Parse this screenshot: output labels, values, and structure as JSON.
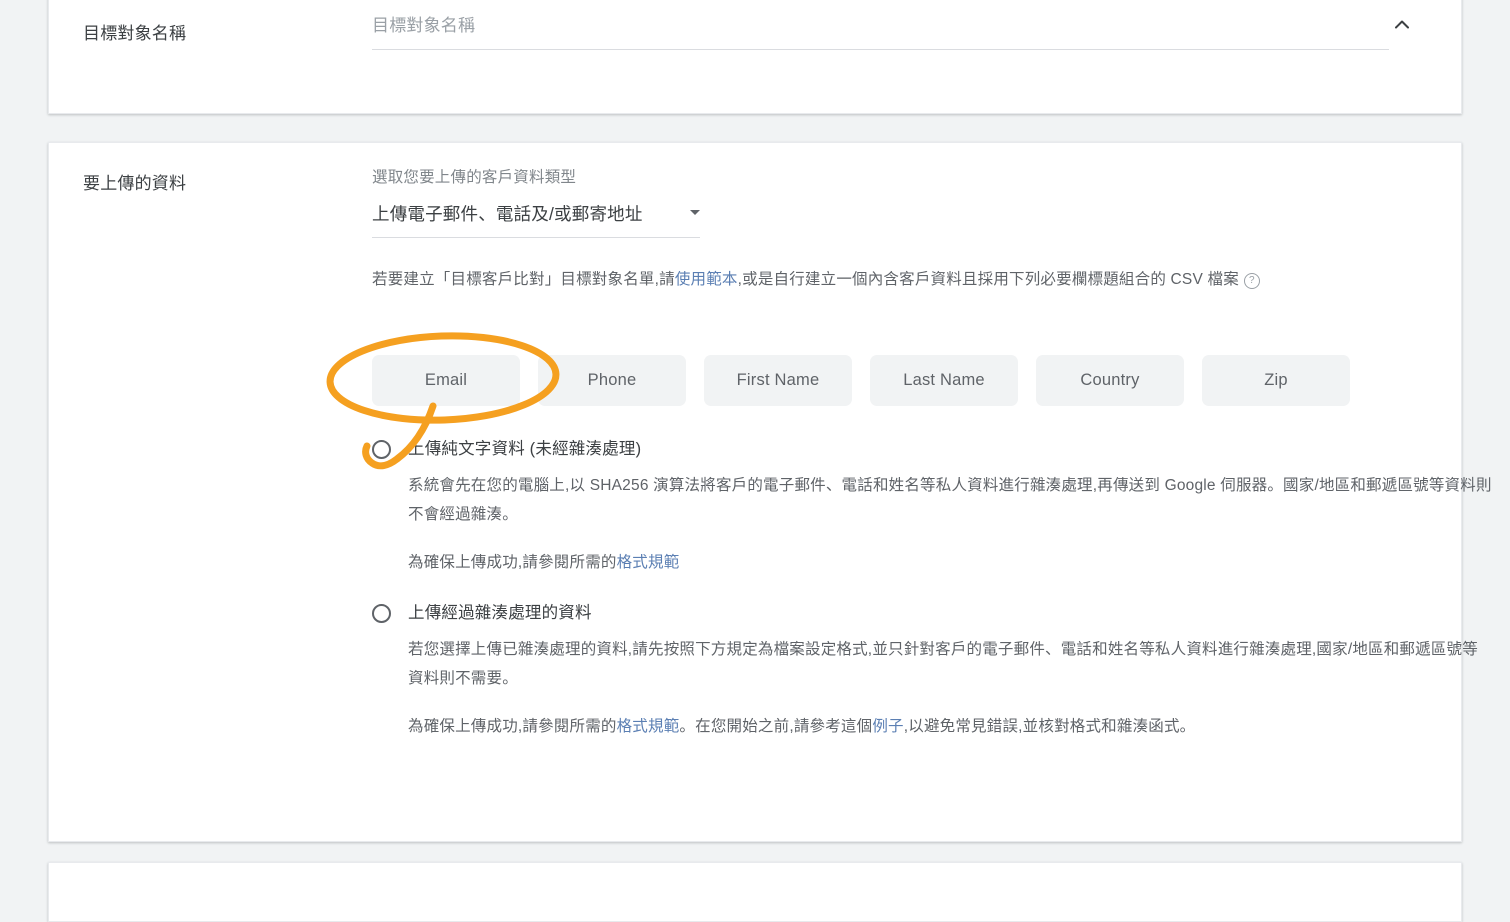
{
  "audience_name_card": {
    "label": "目標對象名稱",
    "input_placeholder": "目標對象名稱",
    "collapse_icon": "chevron-up-icon"
  },
  "upload_card": {
    "label": "要上傳的資料",
    "type_hint": "選取您要上傳的客戶資料類型",
    "type_selected": "上傳電子郵件、電話及/或郵寄地址",
    "description": {
      "part1": "若要建立「目標客戶比對」目標對象名單,請",
      "link": "使用範本",
      "part2": ",或是自行建立一個內含客戶資料且採用下列必要欄標題組合的 CSV 檔案",
      "help_icon": "help-circle-icon"
    },
    "chips": [
      {
        "label": "Email"
      },
      {
        "label": "Phone"
      },
      {
        "label": "First Name"
      },
      {
        "label": "Last Name"
      },
      {
        "label": "Country"
      },
      {
        "label": "Zip"
      }
    ],
    "options": [
      {
        "title": "上傳純文字資料 (未經雜湊處理)",
        "body1": "系統會先在您的電腦上,以 SHA256 演算法將客戶的電子郵件、電話和姓名等私人資料進行雜湊處理,再傳送到 Google 伺服器。國家/地區和郵遞區號等資料則不會經過雜湊。",
        "body2_pre": "為確保上傳成功,請參閱所需的",
        "body2_link": "格式規範",
        "body2_post": "",
        "selected": false
      },
      {
        "title": "上傳經過雜湊處理的資料",
        "body1": "若您選擇上傳已雜湊處理的資料,請先按照下方規定為檔案設定格式,並只針對客戶的電子郵件、電話和姓名等私人資料進行雜湊處理,國家/地區和郵遞區號等資料則不需要。",
        "body2_pre": "為確保上傳成功,請參閱所需的",
        "body2_link": "格式規範",
        "body2_mid": "。在您開始之前,請參考這個",
        "body2_link2": "例子",
        "body2_post": ",以避免常見錯誤,並核對格式和雜湊函式。",
        "selected": false
      }
    ]
  },
  "annotations": {
    "color": "#f5a020",
    "ellipse_target": "Email",
    "arrow_target": "上傳純文字資料 (未經雜湊處理)"
  }
}
